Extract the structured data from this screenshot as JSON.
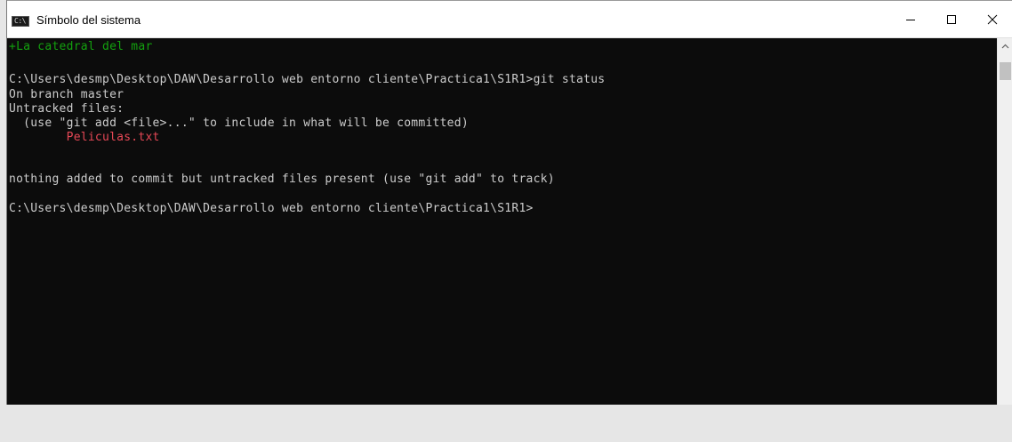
{
  "window": {
    "title": "Símbolo del sistema",
    "icon_label": "C:\\",
    "controls": {
      "minimize_icon": "minimize-icon",
      "maximize_icon": "maximize-icon",
      "close_icon": "close-icon"
    }
  },
  "console": {
    "lines": [
      "+La catedral del mar",
      "",
      "C:\\Users\\desmp\\Desktop\\DAW\\Desarrollo web entorno cliente\\Practica1\\S1R1>git status",
      "On branch master",
      "Untracked files:",
      "  (use \"git add <file>...\" to include in what will be committed)",
      "        Peliculas.txt",
      "",
      "nothing added to commit but untracked files present (use \"git add\" to track)",
      "",
      "C:\\Users\\desmp\\Desktop\\DAW\\Desarrollo web entorno cliente\\Practica1\\S1R1>"
    ],
    "colors": {
      "background": "#0c0c0c",
      "text": "#cccccc",
      "added_line": "#13a10e",
      "untracked_file": "#e74856"
    }
  },
  "scrollbar": {
    "up_icon": "chevron-up-icon"
  }
}
